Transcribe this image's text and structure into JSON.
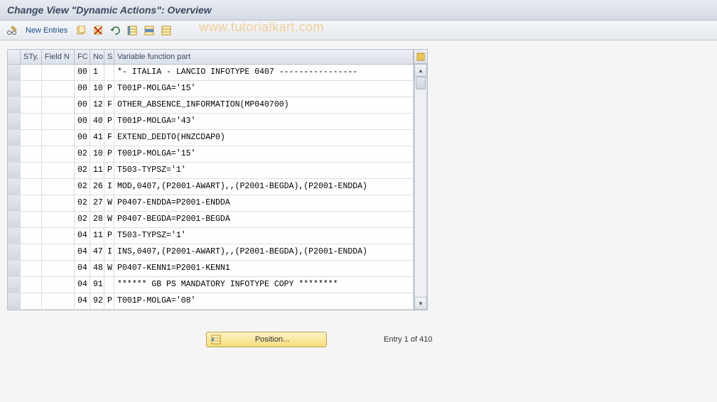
{
  "title": "Change View \"Dynamic Actions\": Overview",
  "watermark": "www.tutorialkart.com",
  "toolbar": {
    "new_entries": "New Entries"
  },
  "table": {
    "headers": {
      "sty": "STy.",
      "field_n": "Field N",
      "fc": "FC",
      "no": "No",
      "s": "S",
      "var": "Variable function part"
    },
    "rows": [
      {
        "sty": "",
        "fieldn": "",
        "fc": "00",
        "no": "1",
        "s": "",
        "var": "  *- ITALIA - LANCIO INFOTYPE 0407 ----------------"
      },
      {
        "sty": "",
        "fieldn": "",
        "fc": "00",
        "no": "10",
        "s": "P",
        "var": "T001P-MOLGA='15'"
      },
      {
        "sty": "",
        "fieldn": "",
        "fc": "00",
        "no": "12",
        "s": "F",
        "var": "OTHER_ABSENCE_INFORMATION(MP040700)"
      },
      {
        "sty": "",
        "fieldn": "",
        "fc": "00",
        "no": "40",
        "s": "P",
        "var": "T001P-MOLGA='43'"
      },
      {
        "sty": "",
        "fieldn": "",
        "fc": "00",
        "no": "41",
        "s": "F",
        "var": "EXTEND_DEDTO(HNZCDAP0)"
      },
      {
        "sty": "",
        "fieldn": "",
        "fc": "02",
        "no": "10",
        "s": "P",
        "var": "T001P-MOLGA='15'"
      },
      {
        "sty": "",
        "fieldn": "",
        "fc": "02",
        "no": "11",
        "s": "P",
        "var": "T503-TYPSZ='1'"
      },
      {
        "sty": "",
        "fieldn": "",
        "fc": "02",
        "no": "26",
        "s": "I",
        "var": "MOD,0407,(P2001-AWART),,(P2001-BEGDA),(P2001-ENDDA)"
      },
      {
        "sty": "",
        "fieldn": "",
        "fc": "02",
        "no": "27",
        "s": "W",
        "var": "P0407-ENDDA=P2001-ENDDA"
      },
      {
        "sty": "",
        "fieldn": "",
        "fc": "02",
        "no": "28",
        "s": "W",
        "var": "P0407-BEGDA=P2001-BEGDA"
      },
      {
        "sty": "",
        "fieldn": "",
        "fc": "04",
        "no": "11",
        "s": "P",
        "var": "T503-TYPSZ='1'"
      },
      {
        "sty": "",
        "fieldn": "",
        "fc": "04",
        "no": "47",
        "s": "I",
        "var": "INS,0407,(P2001-AWART),,(P2001-BEGDA),(P2001-ENDDA)"
      },
      {
        "sty": "",
        "fieldn": "",
        "fc": "04",
        "no": "48",
        "s": "W",
        "var": "P0407-KENN1=P2001-KENN1"
      },
      {
        "sty": "",
        "fieldn": "",
        "fc": "04",
        "no": "91",
        "s": "",
        "var": " ****** GB PS MANDATORY INFOTYPE COPY ********"
      },
      {
        "sty": "",
        "fieldn": "",
        "fc": "04",
        "no": "92",
        "s": "P",
        "var": "T001P-MOLGA='08'"
      }
    ]
  },
  "footer": {
    "position_label": "Position...",
    "entry_text": "Entry 1 of 410"
  }
}
